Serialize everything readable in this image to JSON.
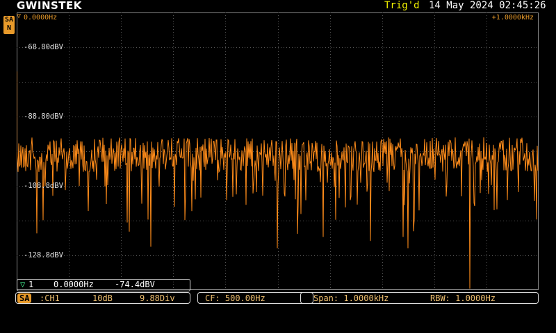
{
  "header": {
    "brand": "GWINSTEK",
    "trigger_status": "Trig'd",
    "datetime": "14 May 2024 02:45:26"
  },
  "mode_badge": {
    "line1": "SA",
    "line2": "N"
  },
  "display": {
    "start_freq": "0.0000Hz",
    "freq_per_div": "+1.0000kHz",
    "y_labels": [
      "-68.80dBV",
      "-88.80dBV",
      "-108.8dBV",
      "-128.8dBV"
    ],
    "trace_color": "#ff8c1a",
    "grid_color": "#555555"
  },
  "marker": {
    "label": "1",
    "freq": "0.0000Hz",
    "level": "-74.4dBV"
  },
  "status": {
    "mode": "SA",
    "channel": ":CH1",
    "scale": "10dB",
    "div": "9.88Div",
    "cf": "CF: 500.00Hz",
    "span": "Span: 1.0000kHz",
    "rbw": "RBW: 1.0000Hz"
  }
}
